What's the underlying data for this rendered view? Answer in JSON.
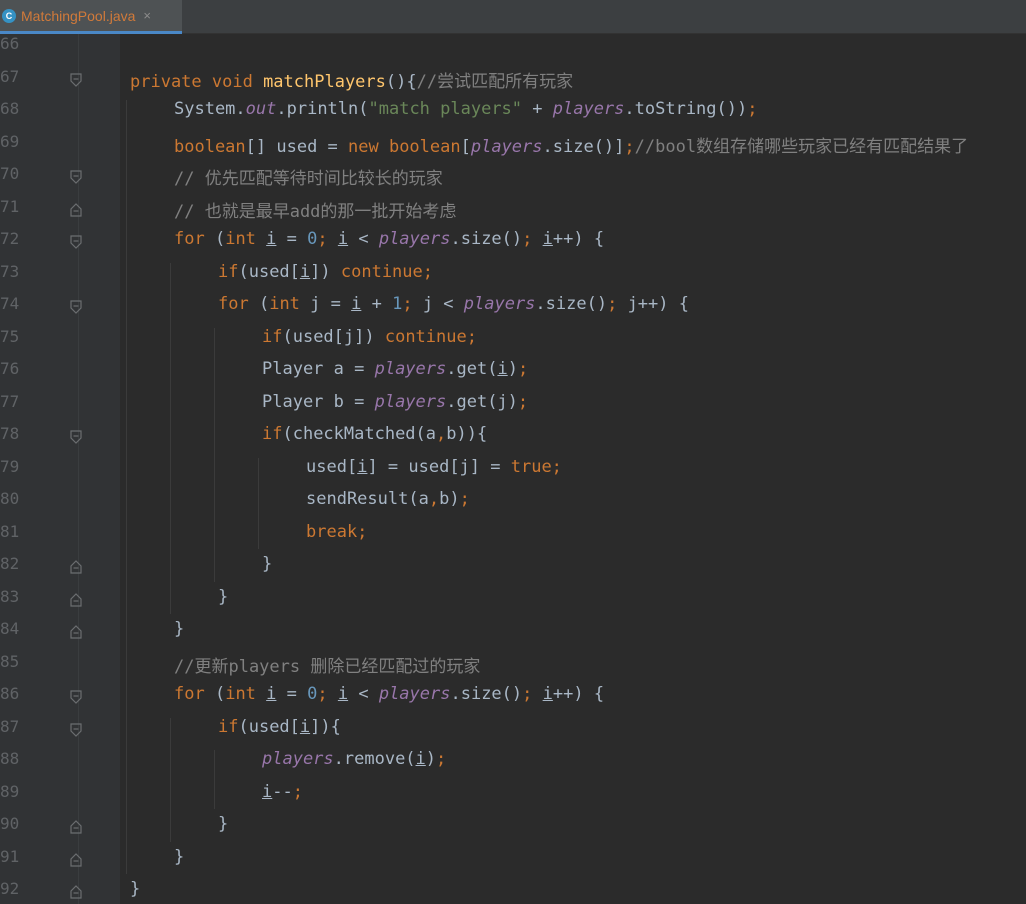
{
  "tab": {
    "icon_letter": "C",
    "file_name": "MatchingPool.java",
    "close": "×"
  },
  "lines": [
    {
      "n": "66",
      "fold": "",
      "indent": 0,
      "tokens": []
    },
    {
      "n": "67",
      "fold": "open",
      "indent": 0,
      "tokens": [
        {
          "t": "private void ",
          "c": "kw"
        },
        {
          "t": "matchPlayers",
          "c": "fn"
        },
        {
          "t": "(){",
          "c": ""
        },
        {
          "t": "//尝试匹配所有玩家",
          "c": "cm"
        }
      ]
    },
    {
      "n": "68",
      "fold": "",
      "indent": 1,
      "tokens": [
        {
          "t": "System.",
          "c": ""
        },
        {
          "t": "out",
          "c": "fld"
        },
        {
          "t": ".println(",
          "c": ""
        },
        {
          "t": "\"match players\"",
          "c": "str"
        },
        {
          "t": " + ",
          "c": ""
        },
        {
          "t": "players",
          "c": "fld"
        },
        {
          "t": ".toString())",
          "c": ""
        },
        {
          "t": ";",
          "c": "kw"
        }
      ]
    },
    {
      "n": "69",
      "fold": "",
      "indent": 1,
      "tokens": [
        {
          "t": "boolean",
          "c": "kw"
        },
        {
          "t": "[] used = ",
          "c": ""
        },
        {
          "t": "new boolean",
          "c": "kw"
        },
        {
          "t": "[",
          "c": ""
        },
        {
          "t": "players",
          "c": "fld"
        },
        {
          "t": ".size()]",
          "c": ""
        },
        {
          "t": ";",
          "c": "kw"
        },
        {
          "t": "//bool数组存储哪些玩家已经有匹配结果了",
          "c": "cm"
        }
      ]
    },
    {
      "n": "70",
      "fold": "open",
      "indent": 1,
      "tokens": [
        {
          "t": "// 优先匹配等待时间比较长的玩家",
          "c": "cm"
        }
      ]
    },
    {
      "n": "71",
      "fold": "close",
      "indent": 1,
      "tokens": [
        {
          "t": "// 也就是最早add的那一批开始考虑",
          "c": "cm"
        }
      ]
    },
    {
      "n": "72",
      "fold": "open",
      "indent": 1,
      "tokens": [
        {
          "t": "for ",
          "c": "kw"
        },
        {
          "t": "(",
          "c": ""
        },
        {
          "t": "int ",
          "c": "kw"
        },
        {
          "t": "i",
          "c": "ul"
        },
        {
          "t": " = ",
          "c": ""
        },
        {
          "t": "0",
          "c": "num"
        },
        {
          "t": "; ",
          "c": "kw"
        },
        {
          "t": "i",
          "c": "ul"
        },
        {
          "t": " < ",
          "c": ""
        },
        {
          "t": "players",
          "c": "fld"
        },
        {
          "t": ".size()",
          "c": ""
        },
        {
          "t": "; ",
          "c": "kw"
        },
        {
          "t": "i",
          "c": "ul"
        },
        {
          "t": "++) {",
          "c": ""
        }
      ]
    },
    {
      "n": "73",
      "fold": "",
      "indent": 2,
      "tokens": [
        {
          "t": "if",
          "c": "kw"
        },
        {
          "t": "(used[",
          "c": ""
        },
        {
          "t": "i",
          "c": "ul"
        },
        {
          "t": "]) ",
          "c": ""
        },
        {
          "t": "continue;",
          "c": "kw"
        }
      ]
    },
    {
      "n": "74",
      "fold": "open",
      "indent": 2,
      "tokens": [
        {
          "t": "for ",
          "c": "kw"
        },
        {
          "t": "(",
          "c": ""
        },
        {
          "t": "int ",
          "c": "kw"
        },
        {
          "t": "j = ",
          "c": ""
        },
        {
          "t": "i",
          "c": "ul"
        },
        {
          "t": " + ",
          "c": ""
        },
        {
          "t": "1",
          "c": "num"
        },
        {
          "t": "; ",
          "c": "kw"
        },
        {
          "t": "j < ",
          "c": ""
        },
        {
          "t": "players",
          "c": "fld"
        },
        {
          "t": ".size()",
          "c": ""
        },
        {
          "t": "; ",
          "c": "kw"
        },
        {
          "t": "j++) {",
          "c": ""
        }
      ]
    },
    {
      "n": "75",
      "fold": "",
      "indent": 3,
      "tokens": [
        {
          "t": "if",
          "c": "kw"
        },
        {
          "t": "(used[j]) ",
          "c": ""
        },
        {
          "t": "continue;",
          "c": "kw"
        }
      ]
    },
    {
      "n": "76",
      "fold": "",
      "indent": 3,
      "tokens": [
        {
          "t": "Player a = ",
          "c": ""
        },
        {
          "t": "players",
          "c": "fld"
        },
        {
          "t": ".get(",
          "c": ""
        },
        {
          "t": "i",
          "c": "ul"
        },
        {
          "t": ")",
          "c": ""
        },
        {
          "t": ";",
          "c": "kw"
        }
      ]
    },
    {
      "n": "77",
      "fold": "",
      "indent": 3,
      "tokens": [
        {
          "t": "Player b = ",
          "c": ""
        },
        {
          "t": "players",
          "c": "fld"
        },
        {
          "t": ".get(j)",
          "c": ""
        },
        {
          "t": ";",
          "c": "kw"
        }
      ]
    },
    {
      "n": "78",
      "fold": "open",
      "indent": 3,
      "tokens": [
        {
          "t": "if",
          "c": "kw"
        },
        {
          "t": "(checkMatched(a",
          "c": ""
        },
        {
          "t": ",",
          "c": "kw"
        },
        {
          "t": "b)){",
          "c": ""
        }
      ]
    },
    {
      "n": "79",
      "fold": "",
      "indent": 4,
      "tokens": [
        {
          "t": "used[",
          "c": ""
        },
        {
          "t": "i",
          "c": "ul"
        },
        {
          "t": "] = used[j] = ",
          "c": ""
        },
        {
          "t": "true;",
          "c": "kw"
        }
      ]
    },
    {
      "n": "80",
      "fold": "",
      "indent": 4,
      "tokens": [
        {
          "t": "sendResult(a",
          "c": ""
        },
        {
          "t": ",",
          "c": "kw"
        },
        {
          "t": "b)",
          "c": ""
        },
        {
          "t": ";",
          "c": "kw"
        }
      ]
    },
    {
      "n": "81",
      "fold": "",
      "indent": 4,
      "tokens": [
        {
          "t": "break;",
          "c": "kw"
        }
      ]
    },
    {
      "n": "82",
      "fold": "close",
      "indent": 3,
      "tokens": [
        {
          "t": "}",
          "c": ""
        }
      ]
    },
    {
      "n": "83",
      "fold": "close",
      "indent": 2,
      "tokens": [
        {
          "t": "}",
          "c": ""
        }
      ]
    },
    {
      "n": "84",
      "fold": "close",
      "indent": 1,
      "tokens": [
        {
          "t": "}",
          "c": ""
        }
      ]
    },
    {
      "n": "85",
      "fold": "",
      "indent": 1,
      "tokens": [
        {
          "t": "//更新players 删除已经匹配过的玩家",
          "c": "cm"
        }
      ]
    },
    {
      "n": "86",
      "fold": "open",
      "indent": 1,
      "tokens": [
        {
          "t": "for ",
          "c": "kw"
        },
        {
          "t": "(",
          "c": ""
        },
        {
          "t": "int ",
          "c": "kw"
        },
        {
          "t": "i",
          "c": "ul"
        },
        {
          "t": " = ",
          "c": ""
        },
        {
          "t": "0",
          "c": "num"
        },
        {
          "t": "; ",
          "c": "kw"
        },
        {
          "t": "i",
          "c": "ul"
        },
        {
          "t": " < ",
          "c": ""
        },
        {
          "t": "players",
          "c": "fld"
        },
        {
          "t": ".size()",
          "c": ""
        },
        {
          "t": "; ",
          "c": "kw"
        },
        {
          "t": "i",
          "c": "ul"
        },
        {
          "t": "++) {",
          "c": ""
        }
      ]
    },
    {
      "n": "87",
      "fold": "open",
      "indent": 2,
      "tokens": [
        {
          "t": "if",
          "c": "kw"
        },
        {
          "t": "(used[",
          "c": ""
        },
        {
          "t": "i",
          "c": "ul"
        },
        {
          "t": "]){",
          "c": ""
        }
      ]
    },
    {
      "n": "88",
      "fold": "",
      "indent": 3,
      "tokens": [
        {
          "t": "players",
          "c": "fld"
        },
        {
          "t": ".remove(",
          "c": ""
        },
        {
          "t": "i",
          "c": "ul"
        },
        {
          "t": ")",
          "c": ""
        },
        {
          "t": ";",
          "c": "kw"
        }
      ]
    },
    {
      "n": "89",
      "fold": "",
      "indent": 3,
      "tokens": [
        {
          "t": "i",
          "c": "ul"
        },
        {
          "t": "--",
          "c": ""
        },
        {
          "t": ";",
          "c": "kw"
        }
      ]
    },
    {
      "n": "90",
      "fold": "close",
      "indent": 2,
      "tokens": [
        {
          "t": "}",
          "c": ""
        }
      ]
    },
    {
      "n": "91",
      "fold": "close",
      "indent": 1,
      "tokens": [
        {
          "t": "}",
          "c": ""
        }
      ]
    },
    {
      "n": "92",
      "fold": "close",
      "indent": 0,
      "tokens": [
        {
          "t": "}",
          "c": ""
        }
      ]
    }
  ]
}
